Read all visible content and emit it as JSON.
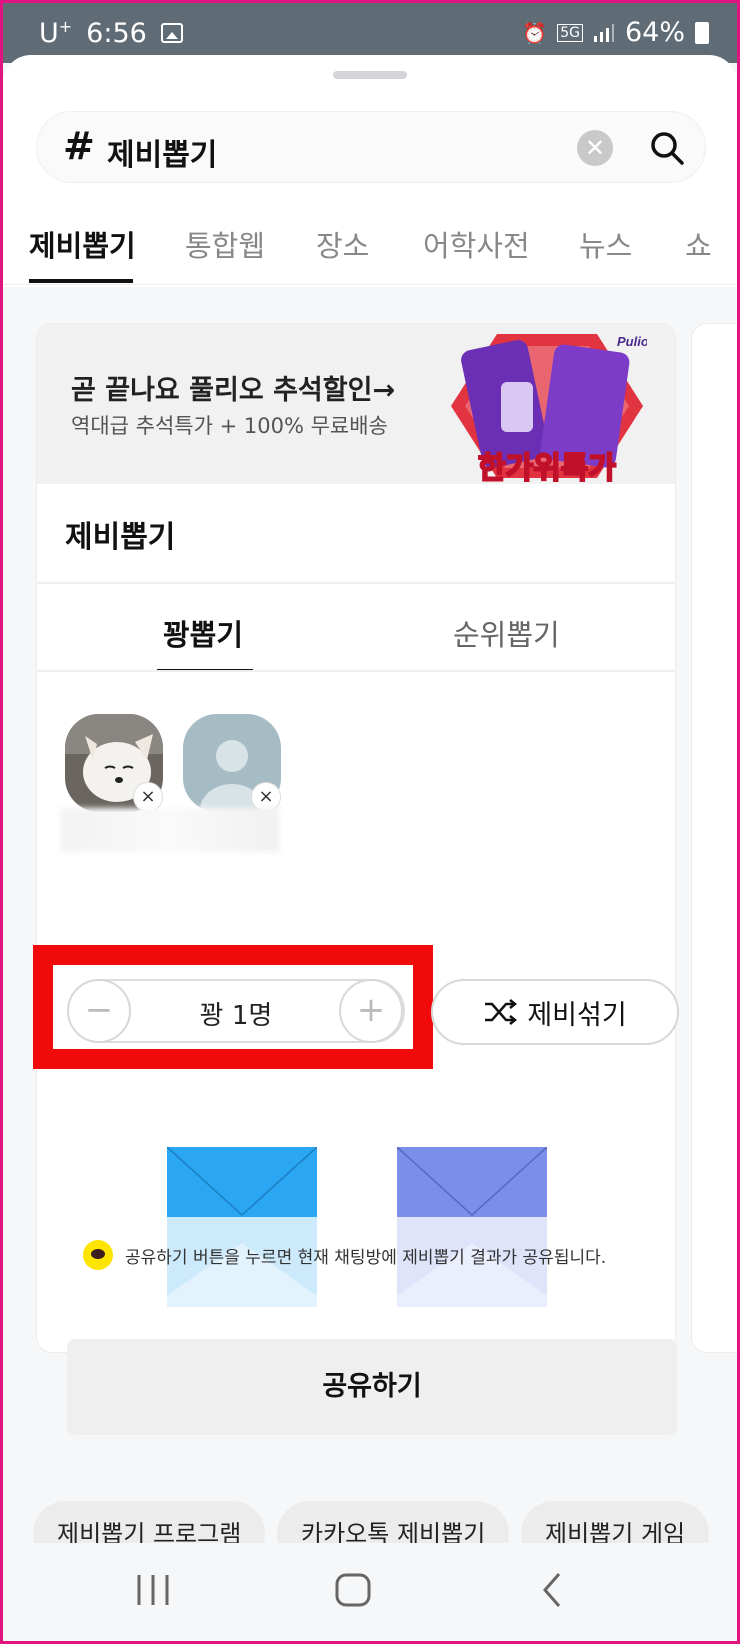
{
  "status_bar": {
    "carrier": "U",
    "carrier_sup": "+",
    "time": "6:56",
    "network": "5G",
    "battery": "64%"
  },
  "search": {
    "hash": "#",
    "query": "제비뽑기",
    "clear_icon": "✕"
  },
  "tabs": [
    {
      "label": "제비뽑기",
      "active": true
    },
    {
      "label": "통합웹"
    },
    {
      "label": "장소"
    },
    {
      "label": "어학사전"
    },
    {
      "label": "뉴스"
    },
    {
      "label": "쇼"
    }
  ],
  "ad": {
    "title": "곧 끝나요 풀리오 추석할인→",
    "subtitle": "역대급 추석특가 + 100% 무료배송",
    "brand": "Pulio",
    "badge": "한가위특가"
  },
  "card": {
    "title": "제비뽑기",
    "subtabs": [
      {
        "label": "꽝뽑기",
        "active": true
      },
      {
        "label": "순위뽑기"
      }
    ],
    "remove_icon": "×"
  },
  "stepper": {
    "minus": "−",
    "plus": "+",
    "value": "꽝 1명"
  },
  "shuffle": {
    "label": "제비섞기"
  },
  "notice": {
    "text": "공유하기 버튼을 누르면 현재 채팅방에 제비뽑기 결과가 공유됩니다."
  },
  "share_button": "공유하기",
  "related": [
    "제비뽑기 프로그램",
    "카카오톡 제비뽑기",
    "제비뽑기 게임"
  ],
  "colors": {
    "highlight": "#f00a0a",
    "envelope_blue": "#2aa6f2",
    "envelope_purple": "#7b8fe8"
  }
}
